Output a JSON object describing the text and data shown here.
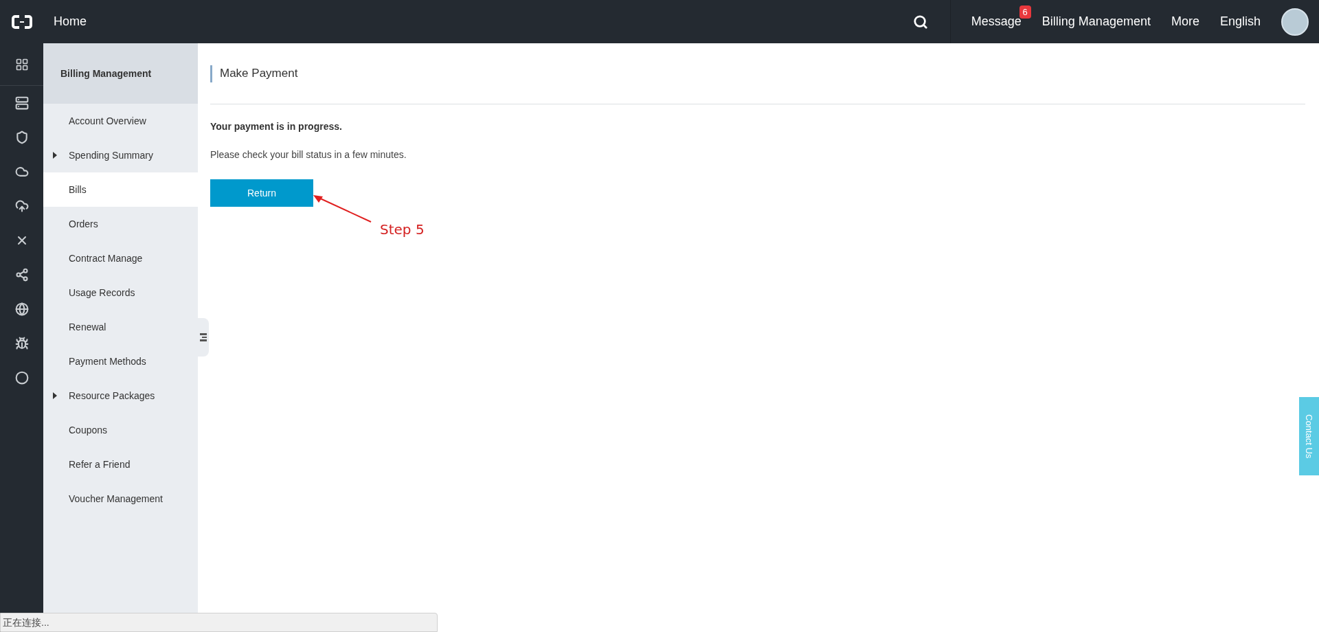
{
  "topbar": {
    "home": "Home",
    "nav": [
      {
        "label": "Message",
        "badge": "6"
      },
      {
        "label": "Billing Management"
      },
      {
        "label": "More"
      },
      {
        "label": "English"
      }
    ]
  },
  "sidebar": {
    "title": "Billing Management",
    "items": [
      {
        "label": "Account Overview",
        "selected": false,
        "expandable": false
      },
      {
        "label": "Spending Summary",
        "selected": false,
        "expandable": true
      },
      {
        "label": "Bills",
        "selected": true,
        "expandable": false
      },
      {
        "label": "Orders",
        "selected": false,
        "expandable": false
      },
      {
        "label": "Contract Manage",
        "selected": false,
        "expandable": false
      },
      {
        "label": "Usage Records",
        "selected": false,
        "expandable": false
      },
      {
        "label": "Renewal",
        "selected": false,
        "expandable": false
      },
      {
        "label": "Payment Methods",
        "selected": false,
        "expandable": false
      },
      {
        "label": "Resource Packages",
        "selected": false,
        "expandable": true
      },
      {
        "label": "Coupons",
        "selected": false,
        "expandable": false
      },
      {
        "label": "Refer a Friend",
        "selected": false,
        "expandable": false
      },
      {
        "label": "Voucher Management",
        "selected": false,
        "expandable": false
      }
    ]
  },
  "content": {
    "title": "Make Payment",
    "heading": "Your payment is in progress.",
    "message": "Please check your bill status in a few minutes.",
    "button": "Return"
  },
  "annotation": {
    "text": "Step 5"
  },
  "contact_tab": "Contact Us",
  "status_bar": "正在连接..."
}
